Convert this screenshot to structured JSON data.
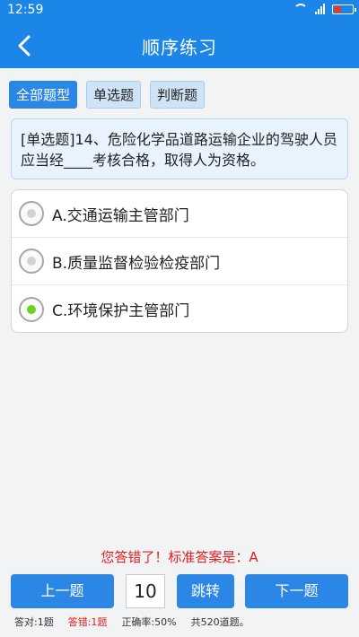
{
  "status_bar": {
    "time": "12:59",
    "icons": [
      "wifi-icon",
      "signal-icon",
      "battery-icon"
    ]
  },
  "header": {
    "title": "顺序练习",
    "back_icon": "chevron-left-icon"
  },
  "tabs": [
    {
      "label": "全部题型",
      "active": true
    },
    {
      "label": "单选题",
      "active": false
    },
    {
      "label": "判断题",
      "active": false
    }
  ],
  "question": {
    "text": "[单选题]14、危险化学品道路运输企业的驾驶人员应当经____考核合格，取得人为资格。"
  },
  "options": [
    {
      "label": "A.交通运输主管部门",
      "selected": false
    },
    {
      "label": "B.质量监督检验检疫部门",
      "selected": false
    },
    {
      "label": "C.环境保护主管部门",
      "selected": true
    }
  ],
  "feedback": "您答错了！标准答案是：A",
  "controls": {
    "prev_label": "上一题",
    "page_value": "10",
    "jump_label": "跳转",
    "next_label": "下一题"
  },
  "stats": {
    "correct": "答对:1题",
    "wrong": "答错:1题",
    "rate": "正确率:50%",
    "total": "共520道题。"
  },
  "colors": {
    "primary": "#1c86e8",
    "button": "#2c86e6",
    "error": "#e02020",
    "selected": "#6fcf21"
  }
}
